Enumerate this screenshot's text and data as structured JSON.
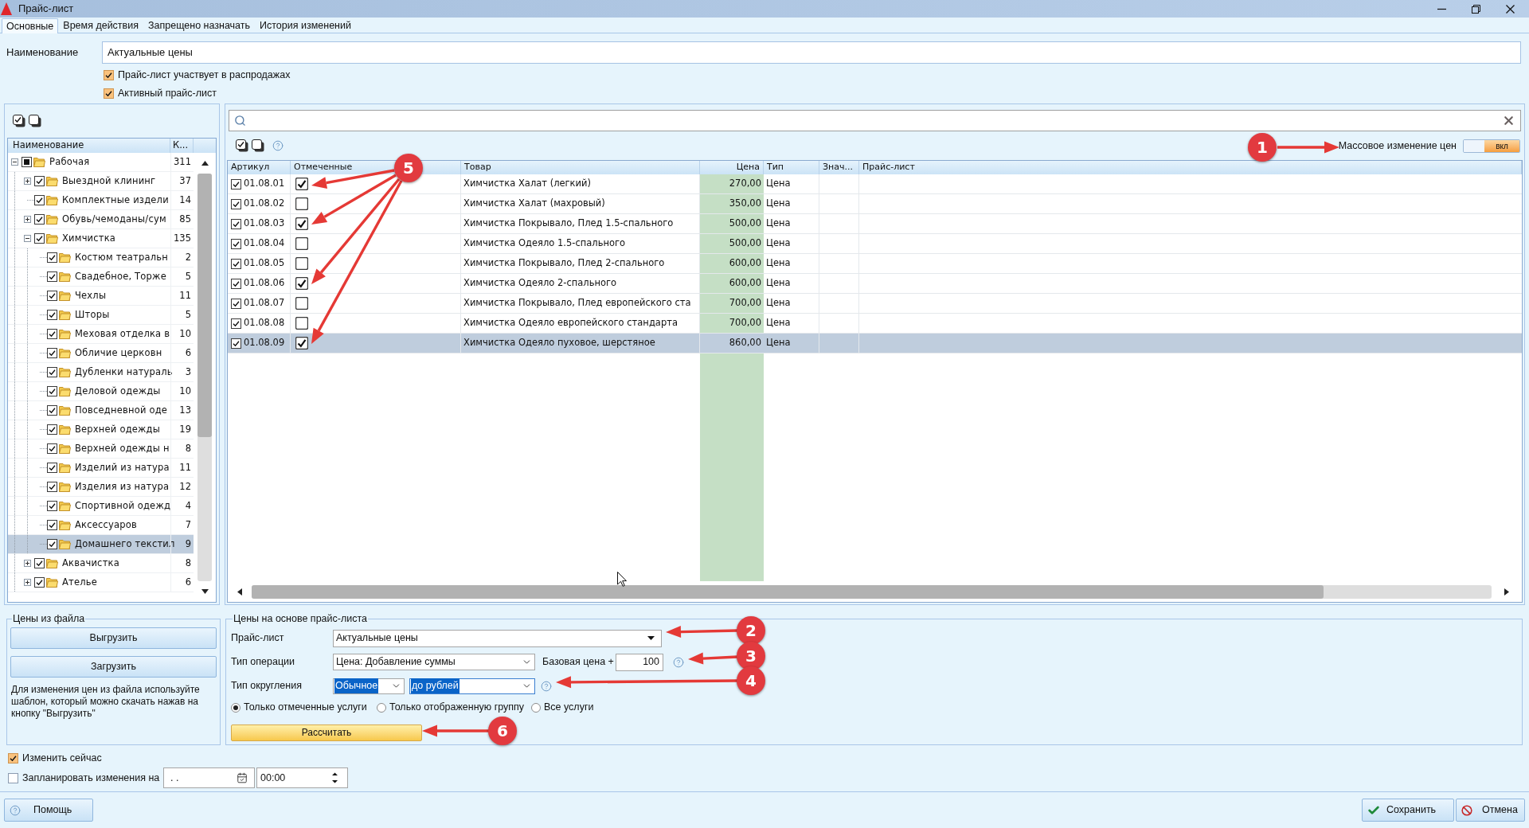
{
  "window": {
    "title": "Прайс-лист"
  },
  "tabs": [
    {
      "label": "Основные",
      "selected": true
    },
    {
      "label": "Время действия",
      "selected": false
    },
    {
      "label": "Запрещено назначать",
      "selected": false
    },
    {
      "label": "История изменений",
      "selected": false
    }
  ],
  "name_field": {
    "label": "Наименование",
    "value": "Актуальные цены"
  },
  "options": [
    {
      "label": "Прайс-лист участвует в распродажах",
      "checked": true
    },
    {
      "label": "Активный прайс-лист",
      "checked": true
    }
  ],
  "tree": {
    "columns": [
      "Наименование",
      "К..."
    ],
    "items": [
      {
        "kind": "group",
        "label": "Рабочая",
        "count": "311",
        "checked": false,
        "partial": true,
        "expanded": true,
        "selected": false,
        "children": [
          {
            "kind": "group",
            "label": "Выездной клининг",
            "count": "37",
            "checked": true,
            "partial": false,
            "expanded": false,
            "selected": false
          },
          {
            "kind": "leaf",
            "label": "Комплектные издели",
            "count": "14",
            "checked": true,
            "partial": false,
            "selected": false
          },
          {
            "kind": "group",
            "label": "Обувь/чемоданы/сум",
            "count": "85",
            "checked": true,
            "partial": false,
            "expanded": false,
            "selected": false
          },
          {
            "kind": "group",
            "label": "Химчистка",
            "count": "135",
            "checked": true,
            "partial": false,
            "expanded": true,
            "selected": false,
            "children": [
              {
                "kind": "leaf",
                "label": "Костюм театральн",
                "count": "2",
                "checked": true,
                "partial": false,
                "selected": false
              },
              {
                "kind": "leaf",
                "label": "Свадебное, Торже",
                "count": "5",
                "checked": true,
                "partial": false,
                "selected": false
              },
              {
                "kind": "leaf",
                "label": "Чехлы",
                "count": "11",
                "checked": true,
                "partial": false,
                "selected": false
              },
              {
                "kind": "leaf",
                "label": "Шторы",
                "count": "5",
                "checked": true,
                "partial": false,
                "selected": false
              },
              {
                "kind": "leaf",
                "label": "Меховая отделка в",
                "count": "10",
                "checked": true,
                "partial": false,
                "selected": false
              },
              {
                "kind": "leaf",
                "label": "Обличие церковн",
                "count": "6",
                "checked": true,
                "partial": false,
                "selected": false
              },
              {
                "kind": "leaf",
                "label": "Дубленки натураль",
                "count": "3",
                "checked": true,
                "partial": false,
                "selected": false
              },
              {
                "kind": "leaf",
                "label": "Деловой одежды",
                "count": "10",
                "checked": true,
                "partial": false,
                "selected": false
              },
              {
                "kind": "leaf",
                "label": "Повседневной оде",
                "count": "13",
                "checked": true,
                "partial": false,
                "selected": false
              },
              {
                "kind": "leaf",
                "label": "Верхней одежды",
                "count": "19",
                "checked": true,
                "partial": false,
                "selected": false
              },
              {
                "kind": "leaf",
                "label": "Верхней одежды н",
                "count": "8",
                "checked": true,
                "partial": false,
                "selected": false
              },
              {
                "kind": "leaf",
                "label": "Изделий из натура",
                "count": "11",
                "checked": true,
                "partial": false,
                "selected": false
              },
              {
                "kind": "leaf",
                "label": "Изделия из натура",
                "count": "12",
                "checked": true,
                "partial": false,
                "selected": false
              },
              {
                "kind": "leaf",
                "label": "Спортивной одежд",
                "count": "4",
                "checked": true,
                "partial": false,
                "selected": false
              },
              {
                "kind": "leaf",
                "label": "Аксессуаров",
                "count": "7",
                "checked": true,
                "partial": false,
                "selected": false
              },
              {
                "kind": "leaf",
                "label": "Домашнего текстил",
                "count": "9",
                "checked": true,
                "partial": false,
                "selected": true
              }
            ]
          },
          {
            "kind": "group",
            "label": "Аквачистка",
            "count": "8",
            "checked": true,
            "partial": false,
            "expanded": false,
            "selected": false
          },
          {
            "kind": "group",
            "label": "Ателье",
            "count": "6",
            "checked": true,
            "partial": false,
            "expanded": false,
            "selected": false
          }
        ]
      }
    ]
  },
  "mass_change": {
    "label": "Массовое изменение цен",
    "on": true,
    "state_text": "вкл"
  },
  "table": {
    "columns": [
      "Артикул",
      "Отмеченные",
      "Товар",
      "Цена",
      "Тип",
      "Знач...",
      "Прайс-лист"
    ],
    "rows": [
      {
        "article": "01.08.01",
        "article_checked": true,
        "marked": true,
        "product": "Химчистка Халат (легкий)",
        "price": "270,00",
        "type": "Цена",
        "selected": false
      },
      {
        "article": "01.08.02",
        "article_checked": true,
        "marked": false,
        "product": "Химчистка Халат (махровый)",
        "price": "350,00",
        "type": "Цена",
        "selected": false
      },
      {
        "article": "01.08.03",
        "article_checked": true,
        "marked": true,
        "product": "Химчистка Покрывало, Плед 1.5-спального",
        "price": "500,00",
        "type": "Цена",
        "selected": false
      },
      {
        "article": "01.08.04",
        "article_checked": true,
        "marked": false,
        "product": "Химчистка Одеяло 1.5-спального",
        "price": "500,00",
        "type": "Цена",
        "selected": false
      },
      {
        "article": "01.08.05",
        "article_checked": true,
        "marked": false,
        "product": "Химчистка Покрывало, Плед 2-спального",
        "price": "600,00",
        "type": "Цена",
        "selected": false
      },
      {
        "article": "01.08.06",
        "article_checked": true,
        "marked": true,
        "product": "Химчистка Одеяло 2-спального",
        "price": "600,00",
        "type": "Цена",
        "selected": false
      },
      {
        "article": "01.08.07",
        "article_checked": true,
        "marked": false,
        "product": "Химчистка Покрывало, Плед европейского ста",
        "price": "700,00",
        "type": "Цена",
        "selected": false
      },
      {
        "article": "01.08.08",
        "article_checked": true,
        "marked": false,
        "product": "Химчистка Одеяло европейского стандарта",
        "price": "700,00",
        "type": "Цена",
        "selected": false
      },
      {
        "article": "01.08.09",
        "article_checked": true,
        "marked": true,
        "product": "Химчистка Одеяло пуховое, шерстяное",
        "price": "860,00",
        "type": "Цена",
        "selected": true
      }
    ]
  },
  "file_prices": {
    "title": "Цены из файла",
    "buttons": [
      "Выгрузить",
      "Загрузить"
    ],
    "note": "Для изменения цен из файла используйте шаблон, который можно скачать нажав на кнопку \"Выгрузить\""
  },
  "pricelist_prices": {
    "title": "Цены на основе прайс-листа",
    "pricelist": {
      "label": "Прайс-лист",
      "value": "Актуальные цены"
    },
    "operation": {
      "label": "Тип операции",
      "value": "Цена: Добавление суммы"
    },
    "base_price": {
      "label": "Базовая цена +",
      "value": "100"
    },
    "rounding": {
      "label": "Тип округления",
      "values": [
        "Обычное",
        "до рублей"
      ]
    },
    "scope": [
      {
        "label": "Только отмеченные услуги",
        "selected": true
      },
      {
        "label": "Только отображенную группу",
        "selected": false
      },
      {
        "label": "Все услуги",
        "selected": false
      }
    ],
    "calculate_button": "Рассчитать"
  },
  "change_now": {
    "label": "Изменить сейчас",
    "checked": true
  },
  "schedule": {
    "label": "Запланировать изменения на",
    "checked": false,
    "date": ". .",
    "time": "00:00"
  },
  "footer": {
    "help": "Помощь",
    "save": "Сохранить",
    "cancel": "Отмена"
  },
  "annotations": [
    {
      "label": "1"
    },
    {
      "label": "2"
    },
    {
      "label": "3"
    },
    {
      "label": "4"
    },
    {
      "label": "5"
    },
    {
      "label": "6"
    }
  ]
}
